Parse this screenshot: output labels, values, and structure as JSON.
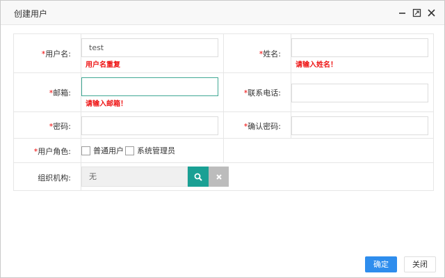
{
  "dialog": {
    "title": "创建用户",
    "controls": {
      "minimize": "minimize-icon",
      "maximize": "maximize-icon",
      "close": "close-icon"
    }
  },
  "form": {
    "required_mark": "*",
    "username": {
      "label": "用户名:",
      "value": "test",
      "error": "用户名重复"
    },
    "fullname": {
      "label": "姓名:",
      "value": "",
      "error": "请输入姓名！"
    },
    "email": {
      "label": "邮箱:",
      "value": "",
      "error": "请输入邮箱！"
    },
    "phone": {
      "label": "联系电话:",
      "value": ""
    },
    "password": {
      "label": "密码:",
      "value": ""
    },
    "confirm_password": {
      "label": "确认密码:",
      "value": ""
    },
    "role": {
      "label": "用户角色:",
      "options": [
        {
          "label": "普通用户",
          "checked": false
        },
        {
          "label": "系统管理员",
          "checked": false
        }
      ]
    },
    "organization": {
      "label": "组织机构:",
      "value": "无",
      "search_icon": "search-icon",
      "clear_icon": "clear-icon"
    }
  },
  "footer": {
    "ok_label": "确定",
    "close_label": "关闭"
  },
  "colors": {
    "accent": "#2e8ded",
    "error": "#e11111",
    "search_btn": "#1aa094",
    "clear_btn": "#bcbcbc",
    "focus_border": "#40a894"
  }
}
